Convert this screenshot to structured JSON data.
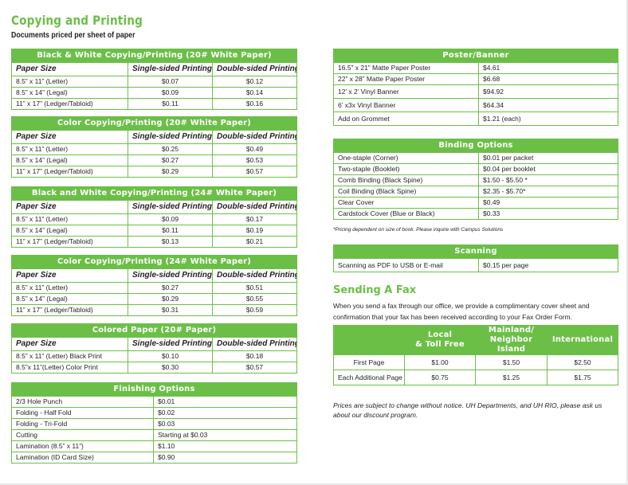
{
  "header": {
    "title": "Copying and Printing",
    "subtitle": "Documents priced per sheet of paper"
  },
  "colors": {
    "accent": "#6bbf47"
  },
  "columns": {
    "paper_size": "Paper Size",
    "single": "Single-sided Printing",
    "double": "Double-sided Printing"
  },
  "bw20": {
    "title": "Black & White Copying/Printing (20# White Paper)",
    "rows": [
      {
        "size": "8.5” x 11” (Letter)",
        "single": "$0.07",
        "double": "$0.12"
      },
      {
        "size": "8.5” x 14” (Legal)",
        "single": "$0.09",
        "double": "$0.14"
      },
      {
        "size": "11” x 17” (Ledger/Tabloid)",
        "single": "$0.11",
        "double": "$0.16"
      }
    ]
  },
  "color20": {
    "title": "Color Copying/Printing (20# White Paper)",
    "rows": [
      {
        "size": "8.5” x 11” (Letter)",
        "single": "$0.25",
        "double": "$0.49"
      },
      {
        "size": "8.5” x 14” (Legal)",
        "single": "$0.27",
        "double": "$0.53"
      },
      {
        "size": "11” x 17” (Ledger/Tabloid)",
        "single": "$0.29",
        "double": "$0.57"
      }
    ]
  },
  "bw24": {
    "title": "Black and White Copying/Printing (24# White Paper)",
    "rows": [
      {
        "size": "8.5” x 11” (Letter)",
        "single": "$0.09",
        "double": "$0.17"
      },
      {
        "size": "8.5” x 14” (Legal)",
        "single": "$0.11",
        "double": "$0.19"
      },
      {
        "size": "11” x 17” (Ledger/Tabloid)",
        "single": "$0.13",
        "double": "$0.21"
      }
    ]
  },
  "color24": {
    "title": "Color Copying/Printing (24# White Paper)",
    "rows": [
      {
        "size": "8.5” x 11” (Letter)",
        "single": "$0.27",
        "double": "$0.51"
      },
      {
        "size": "8.5” x 14” (Legal)",
        "single": "$0.29",
        "double": "$0.55"
      },
      {
        "size": "11” x 17” (Ledger/Tabloid)",
        "single": "$0.31",
        "double": "$0.59"
      }
    ]
  },
  "colored": {
    "title": "Colored Paper (20# Paper)",
    "rows": [
      {
        "size": "8.5” x 11” (Letter) Black Print",
        "single": "$0.10",
        "double": "$0.18"
      },
      {
        "size": "8.5”x 11”(Letter) Color Print",
        "single": "$0.30",
        "double": "$0.57"
      }
    ]
  },
  "finishing": {
    "title": "Finishing Options",
    "rows": [
      {
        "item": "2/3 Hole Punch",
        "price": "$0.01"
      },
      {
        "item": "Folding - Half Fold",
        "price": "$0.02"
      },
      {
        "item": "Folding - Tri-Fold",
        "price": "$0.03"
      },
      {
        "item": "Cutting",
        "price": "Starting at $0.03"
      },
      {
        "item": "Lamination (8.5” x 11”)",
        "price": "$1.10"
      },
      {
        "item": "Lamination (ID Card Size)",
        "price": "$0.90"
      }
    ]
  },
  "poster": {
    "title": "Poster/Banner",
    "rows": [
      {
        "item": "16.5” x 21” Matte Paper Poster",
        "price": "$4.61"
      },
      {
        "item": "22” x 28” Matte Paper Poster",
        "price": "$6.68"
      },
      {
        "item": "12’ x 2’ Vinyl Banner",
        "price": "$94.92"
      },
      {
        "item": "6’ x3x Vinyl Banner",
        "price": "$64.34"
      },
      {
        "item": "Add on Grommet",
        "price": "$1.21 (each)"
      }
    ]
  },
  "binding": {
    "title": "Binding Options",
    "rows": [
      {
        "item": "One-staple (Corner)",
        "price": "$0.01 per packet"
      },
      {
        "item": "Two-staple (Booklet)",
        "price": "$0.04 per booklet"
      },
      {
        "item": "Comb Binding (Black Spine)",
        "price": "$1.50 - $5.50 *"
      },
      {
        "item": "Coil Binding (Black Spine)",
        "price": "$2.35 - $5.70*"
      },
      {
        "item": "Clear Cover",
        "price": "$0.49"
      },
      {
        "item": "Cardstock Cover (Blue or Black)",
        "price": "$0.33"
      }
    ],
    "note": "*Pricing dependent on size of book. Please inquire with Campus Solutions"
  },
  "scanning": {
    "title": "Scanning",
    "rows": [
      {
        "item": "Scanning as PDF to USB or E-mail",
        "price": "$0.15 per page"
      }
    ]
  },
  "fax": {
    "title": "Sending A Fax",
    "description": "When you send a fax through our office, we provide a complimentary cover sheet and confirmation that your fax has been received according to your Fax Order Form.",
    "headers": [
      "",
      "Local\n& Toll Free",
      "Mainland/\nNeighbor Island",
      "International"
    ],
    "rows": [
      {
        "label": "First Page",
        "local": "$1.00",
        "mainland": "$1.50",
        "intl": "$2.50"
      },
      {
        "label": "Each Additional Page",
        "local": "$0.75",
        "mainland": "$1.25",
        "intl": "$1.75"
      }
    ]
  },
  "disclaimer": "Prices are subject to change without notice. UH Departments, and UH RIO, please ask us about our discount program."
}
